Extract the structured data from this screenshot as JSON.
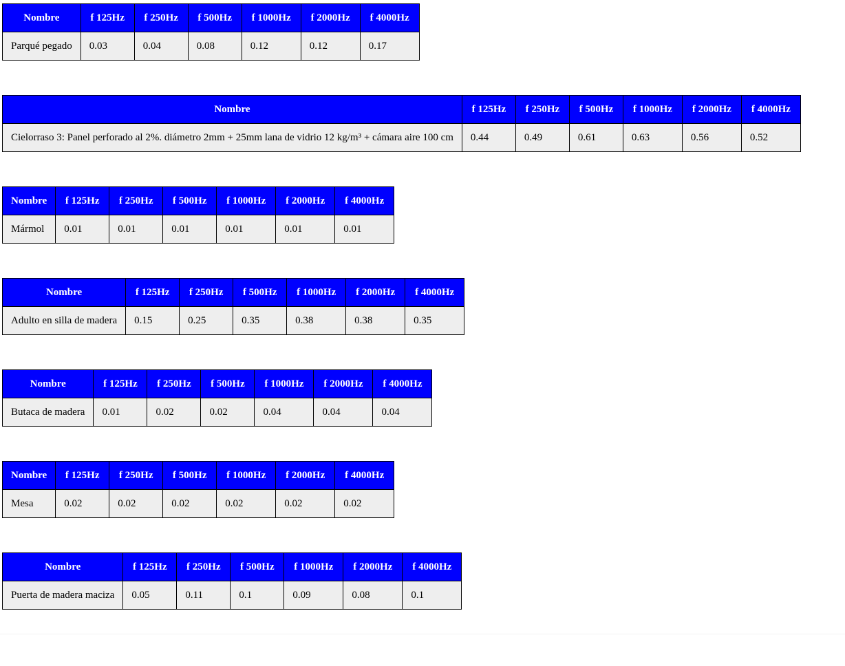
{
  "header": {
    "name": "Nombre",
    "f125": "f 125Hz",
    "f250": "f 250Hz",
    "f500": "f 500Hz",
    "f1000": "f 1000Hz",
    "f2000": "f 2000Hz",
    "f4000": "f 4000Hz"
  },
  "materials": [
    {
      "name": "Parqué pegado",
      "f125": "0.03",
      "f250": "0.04",
      "f500": "0.08",
      "f1000": "0.12",
      "f2000": "0.12",
      "f4000": "0.17"
    },
    {
      "name": "Cielorraso 3: Panel perforado al 2%. diámetro 2mm + 25mm lana de vidrio 12 kg/m³ + cámara aire 100 cm",
      "f125": "0.44",
      "f250": "0.49",
      "f500": "0.61",
      "f1000": "0.63",
      "f2000": "0.56",
      "f4000": "0.52"
    },
    {
      "name": "Mármol",
      "f125": "0.01",
      "f250": "0.01",
      "f500": "0.01",
      "f1000": "0.01",
      "f2000": "0.01",
      "f4000": "0.01"
    },
    {
      "name": "Adulto en silla de madera",
      "f125": "0.15",
      "f250": "0.25",
      "f500": "0.35",
      "f1000": "0.38",
      "f2000": "0.38",
      "f4000": "0.35"
    },
    {
      "name": "Butaca de madera",
      "f125": "0.01",
      "f250": "0.02",
      "f500": "0.02",
      "f1000": "0.04",
      "f2000": "0.04",
      "f4000": "0.04"
    },
    {
      "name": "Mesa",
      "f125": "0.02",
      "f250": "0.02",
      "f500": "0.02",
      "f1000": "0.02",
      "f2000": "0.02",
      "f4000": "0.02"
    },
    {
      "name": "Puerta de madera maciza",
      "f125": "0.05",
      "f250": "0.11",
      "f500": "0.1",
      "f1000": "0.09",
      "f2000": "0.08",
      "f4000": "0.1"
    }
  ]
}
